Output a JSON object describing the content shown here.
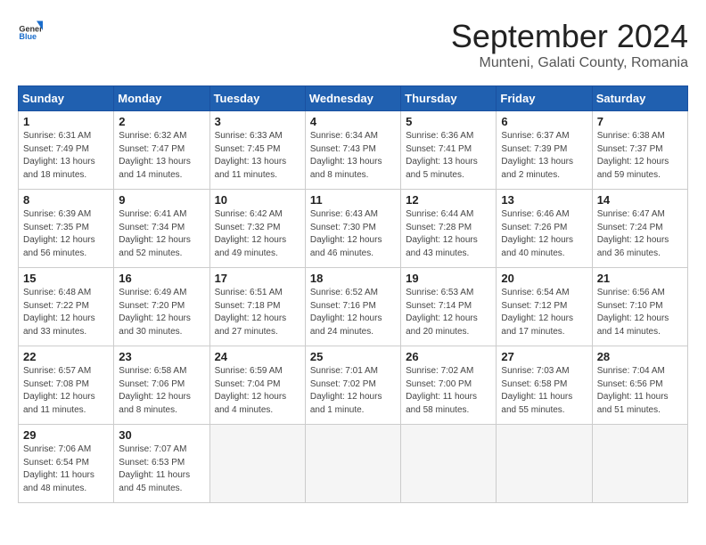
{
  "header": {
    "logo_general": "General",
    "logo_blue": "Blue",
    "month_title": "September 2024",
    "location": "Munteni, Galati County, Romania"
  },
  "columns": [
    "Sunday",
    "Monday",
    "Tuesday",
    "Wednesday",
    "Thursday",
    "Friday",
    "Saturday"
  ],
  "weeks": [
    [
      {
        "day": "1",
        "sunrise": "Sunrise: 6:31 AM",
        "sunset": "Sunset: 7:49 PM",
        "daylight": "Daylight: 13 hours and 18 minutes."
      },
      {
        "day": "2",
        "sunrise": "Sunrise: 6:32 AM",
        "sunset": "Sunset: 7:47 PM",
        "daylight": "Daylight: 13 hours and 14 minutes."
      },
      {
        "day": "3",
        "sunrise": "Sunrise: 6:33 AM",
        "sunset": "Sunset: 7:45 PM",
        "daylight": "Daylight: 13 hours and 11 minutes."
      },
      {
        "day": "4",
        "sunrise": "Sunrise: 6:34 AM",
        "sunset": "Sunset: 7:43 PM",
        "daylight": "Daylight: 13 hours and 8 minutes."
      },
      {
        "day": "5",
        "sunrise": "Sunrise: 6:36 AM",
        "sunset": "Sunset: 7:41 PM",
        "daylight": "Daylight: 13 hours and 5 minutes."
      },
      {
        "day": "6",
        "sunrise": "Sunrise: 6:37 AM",
        "sunset": "Sunset: 7:39 PM",
        "daylight": "Daylight: 13 hours and 2 minutes."
      },
      {
        "day": "7",
        "sunrise": "Sunrise: 6:38 AM",
        "sunset": "Sunset: 7:37 PM",
        "daylight": "Daylight: 12 hours and 59 minutes."
      }
    ],
    [
      {
        "day": "8",
        "sunrise": "Sunrise: 6:39 AM",
        "sunset": "Sunset: 7:35 PM",
        "daylight": "Daylight: 12 hours and 56 minutes."
      },
      {
        "day": "9",
        "sunrise": "Sunrise: 6:41 AM",
        "sunset": "Sunset: 7:34 PM",
        "daylight": "Daylight: 12 hours and 52 minutes."
      },
      {
        "day": "10",
        "sunrise": "Sunrise: 6:42 AM",
        "sunset": "Sunset: 7:32 PM",
        "daylight": "Daylight: 12 hours and 49 minutes."
      },
      {
        "day": "11",
        "sunrise": "Sunrise: 6:43 AM",
        "sunset": "Sunset: 7:30 PM",
        "daylight": "Daylight: 12 hours and 46 minutes."
      },
      {
        "day": "12",
        "sunrise": "Sunrise: 6:44 AM",
        "sunset": "Sunset: 7:28 PM",
        "daylight": "Daylight: 12 hours and 43 minutes."
      },
      {
        "day": "13",
        "sunrise": "Sunrise: 6:46 AM",
        "sunset": "Sunset: 7:26 PM",
        "daylight": "Daylight: 12 hours and 40 minutes."
      },
      {
        "day": "14",
        "sunrise": "Sunrise: 6:47 AM",
        "sunset": "Sunset: 7:24 PM",
        "daylight": "Daylight: 12 hours and 36 minutes."
      }
    ],
    [
      {
        "day": "15",
        "sunrise": "Sunrise: 6:48 AM",
        "sunset": "Sunset: 7:22 PM",
        "daylight": "Daylight: 12 hours and 33 minutes."
      },
      {
        "day": "16",
        "sunrise": "Sunrise: 6:49 AM",
        "sunset": "Sunset: 7:20 PM",
        "daylight": "Daylight: 12 hours and 30 minutes."
      },
      {
        "day": "17",
        "sunrise": "Sunrise: 6:51 AM",
        "sunset": "Sunset: 7:18 PM",
        "daylight": "Daylight: 12 hours and 27 minutes."
      },
      {
        "day": "18",
        "sunrise": "Sunrise: 6:52 AM",
        "sunset": "Sunset: 7:16 PM",
        "daylight": "Daylight: 12 hours and 24 minutes."
      },
      {
        "day": "19",
        "sunrise": "Sunrise: 6:53 AM",
        "sunset": "Sunset: 7:14 PM",
        "daylight": "Daylight: 12 hours and 20 minutes."
      },
      {
        "day": "20",
        "sunrise": "Sunrise: 6:54 AM",
        "sunset": "Sunset: 7:12 PM",
        "daylight": "Daylight: 12 hours and 17 minutes."
      },
      {
        "day": "21",
        "sunrise": "Sunrise: 6:56 AM",
        "sunset": "Sunset: 7:10 PM",
        "daylight": "Daylight: 12 hours and 14 minutes."
      }
    ],
    [
      {
        "day": "22",
        "sunrise": "Sunrise: 6:57 AM",
        "sunset": "Sunset: 7:08 PM",
        "daylight": "Daylight: 12 hours and 11 minutes."
      },
      {
        "day": "23",
        "sunrise": "Sunrise: 6:58 AM",
        "sunset": "Sunset: 7:06 PM",
        "daylight": "Daylight: 12 hours and 8 minutes."
      },
      {
        "day": "24",
        "sunrise": "Sunrise: 6:59 AM",
        "sunset": "Sunset: 7:04 PM",
        "daylight": "Daylight: 12 hours and 4 minutes."
      },
      {
        "day": "25",
        "sunrise": "Sunrise: 7:01 AM",
        "sunset": "Sunset: 7:02 PM",
        "daylight": "Daylight: 12 hours and 1 minute."
      },
      {
        "day": "26",
        "sunrise": "Sunrise: 7:02 AM",
        "sunset": "Sunset: 7:00 PM",
        "daylight": "Daylight: 11 hours and 58 minutes."
      },
      {
        "day": "27",
        "sunrise": "Sunrise: 7:03 AM",
        "sunset": "Sunset: 6:58 PM",
        "daylight": "Daylight: 11 hours and 55 minutes."
      },
      {
        "day": "28",
        "sunrise": "Sunrise: 7:04 AM",
        "sunset": "Sunset: 6:56 PM",
        "daylight": "Daylight: 11 hours and 51 minutes."
      }
    ],
    [
      {
        "day": "29",
        "sunrise": "Sunrise: 7:06 AM",
        "sunset": "Sunset: 6:54 PM",
        "daylight": "Daylight: 11 hours and 48 minutes."
      },
      {
        "day": "30",
        "sunrise": "Sunrise: 7:07 AM",
        "sunset": "Sunset: 6:53 PM",
        "daylight": "Daylight: 11 hours and 45 minutes."
      },
      null,
      null,
      null,
      null,
      null
    ]
  ]
}
